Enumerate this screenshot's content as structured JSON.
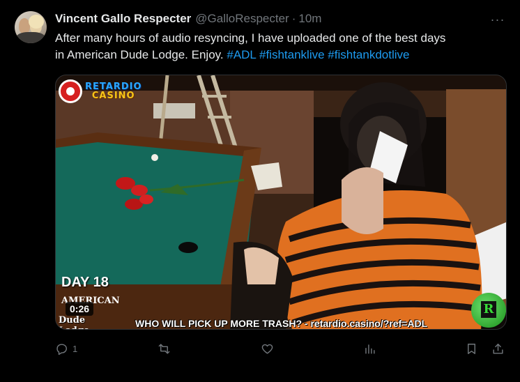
{
  "tweet": {
    "author": {
      "display_name": "Vincent Gallo Respecter",
      "handle": "@GalloRespecter",
      "separator": "·",
      "time": "10m"
    },
    "text_lines": [
      "After many hours of audio resyncing, I have uploaded one of the best days",
      "in American Dude Lodge. Enjoy."
    ],
    "hashtags": [
      "#ADL",
      "#fishtanklive",
      "#fishtankdotlive"
    ],
    "more_label": "···"
  },
  "media": {
    "logo": {
      "line1": "RETARDIO",
      "line2": "CASINO"
    },
    "day_label": "DAY 18",
    "show_logo": {
      "top": "AMERICAN",
      "bottom": "Dude Lodge"
    },
    "duration": "0:26",
    "caption": "WHO WILL PICK UP MORE TRASH? - retardio.casino/?ref=ADL",
    "badge_letter": "R"
  },
  "actions": {
    "reply_count": "1",
    "repost_count": "",
    "like_count": "",
    "views_count": ""
  },
  "icons": [
    "avatar",
    "more-icon",
    "reply-icon",
    "repost-icon",
    "like-icon",
    "views-icon",
    "bookmark-icon",
    "share-icon"
  ],
  "colors": {
    "background": "#000000",
    "text": "#e7e9ea",
    "muted": "#71767b",
    "link": "#1d9bf0"
  }
}
